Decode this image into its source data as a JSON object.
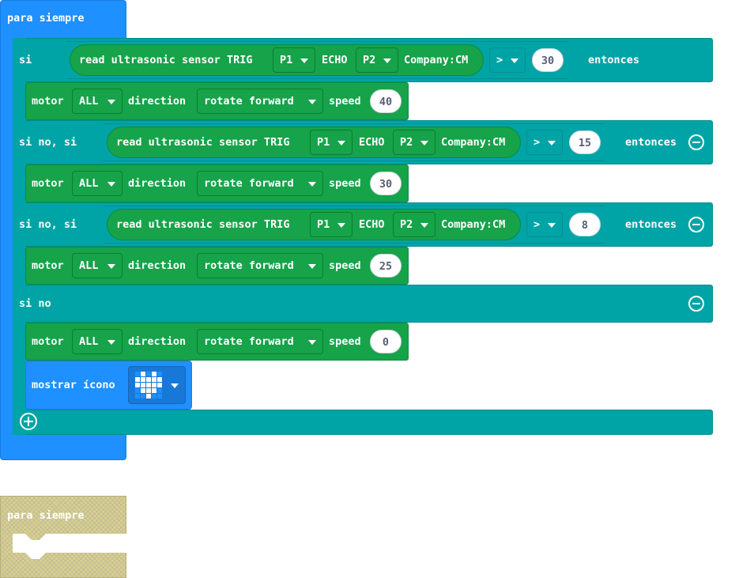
{
  "colors": {
    "loops_blue": "#1e90ff",
    "logic_teal": "#00a4a6",
    "motor_green": "#16a34a",
    "ghost_khaki": "#d8cf8f"
  },
  "forever1": {
    "label": "para siempre"
  },
  "forever2": {
    "label": "para siempre"
  },
  "if_block": {
    "clauses": [
      {
        "keyword": "si",
        "then": "entonces",
        "condition": {
          "sensor": "read ultrasonic sensor TRIG",
          "trig": "P1",
          "echo_label": "ECHO",
          "echo": "P2",
          "unit": "Company:CM",
          "op": ">",
          "value": "30"
        },
        "action": {
          "motor_label": "motor",
          "motor": "ALL",
          "direction_label": "direction",
          "direction": "rotate forward",
          "speed_label": "speed",
          "speed": "40"
        }
      },
      {
        "keyword": "si no, si",
        "then": "entonces",
        "condition": {
          "sensor": "read ultrasonic sensor TRIG",
          "trig": "P1",
          "echo_label": "ECHO",
          "echo": "P2",
          "unit": "Company:CM",
          "op": ">",
          "value": "15"
        },
        "action": {
          "motor_label": "motor",
          "motor": "ALL",
          "direction_label": "direction",
          "direction": "rotate forward",
          "speed_label": "speed",
          "speed": "30"
        }
      },
      {
        "keyword": "si no, si",
        "then": "entonces",
        "condition": {
          "sensor": "read ultrasonic sensor TRIG",
          "trig": "P1",
          "echo_label": "ECHO",
          "echo": "P2",
          "unit": "Company:CM",
          "op": ">",
          "value": "8"
        },
        "action": {
          "motor_label": "motor",
          "motor": "ALL",
          "direction_label": "direction",
          "direction": "rotate forward",
          "speed_label": "speed",
          "speed": "25"
        }
      }
    ],
    "else": {
      "keyword": "si no",
      "action": {
        "motor_label": "motor",
        "motor": "ALL",
        "direction_label": "direction",
        "direction": "rotate forward",
        "speed_label": "speed",
        "speed": "0"
      },
      "show_icon": {
        "label": "mostrar ícono",
        "icon": "heart-icon"
      }
    }
  },
  "icons": {
    "remove": "minus-circle-icon",
    "add": "plus-circle-icon",
    "dropdown": "caret-down-icon"
  }
}
